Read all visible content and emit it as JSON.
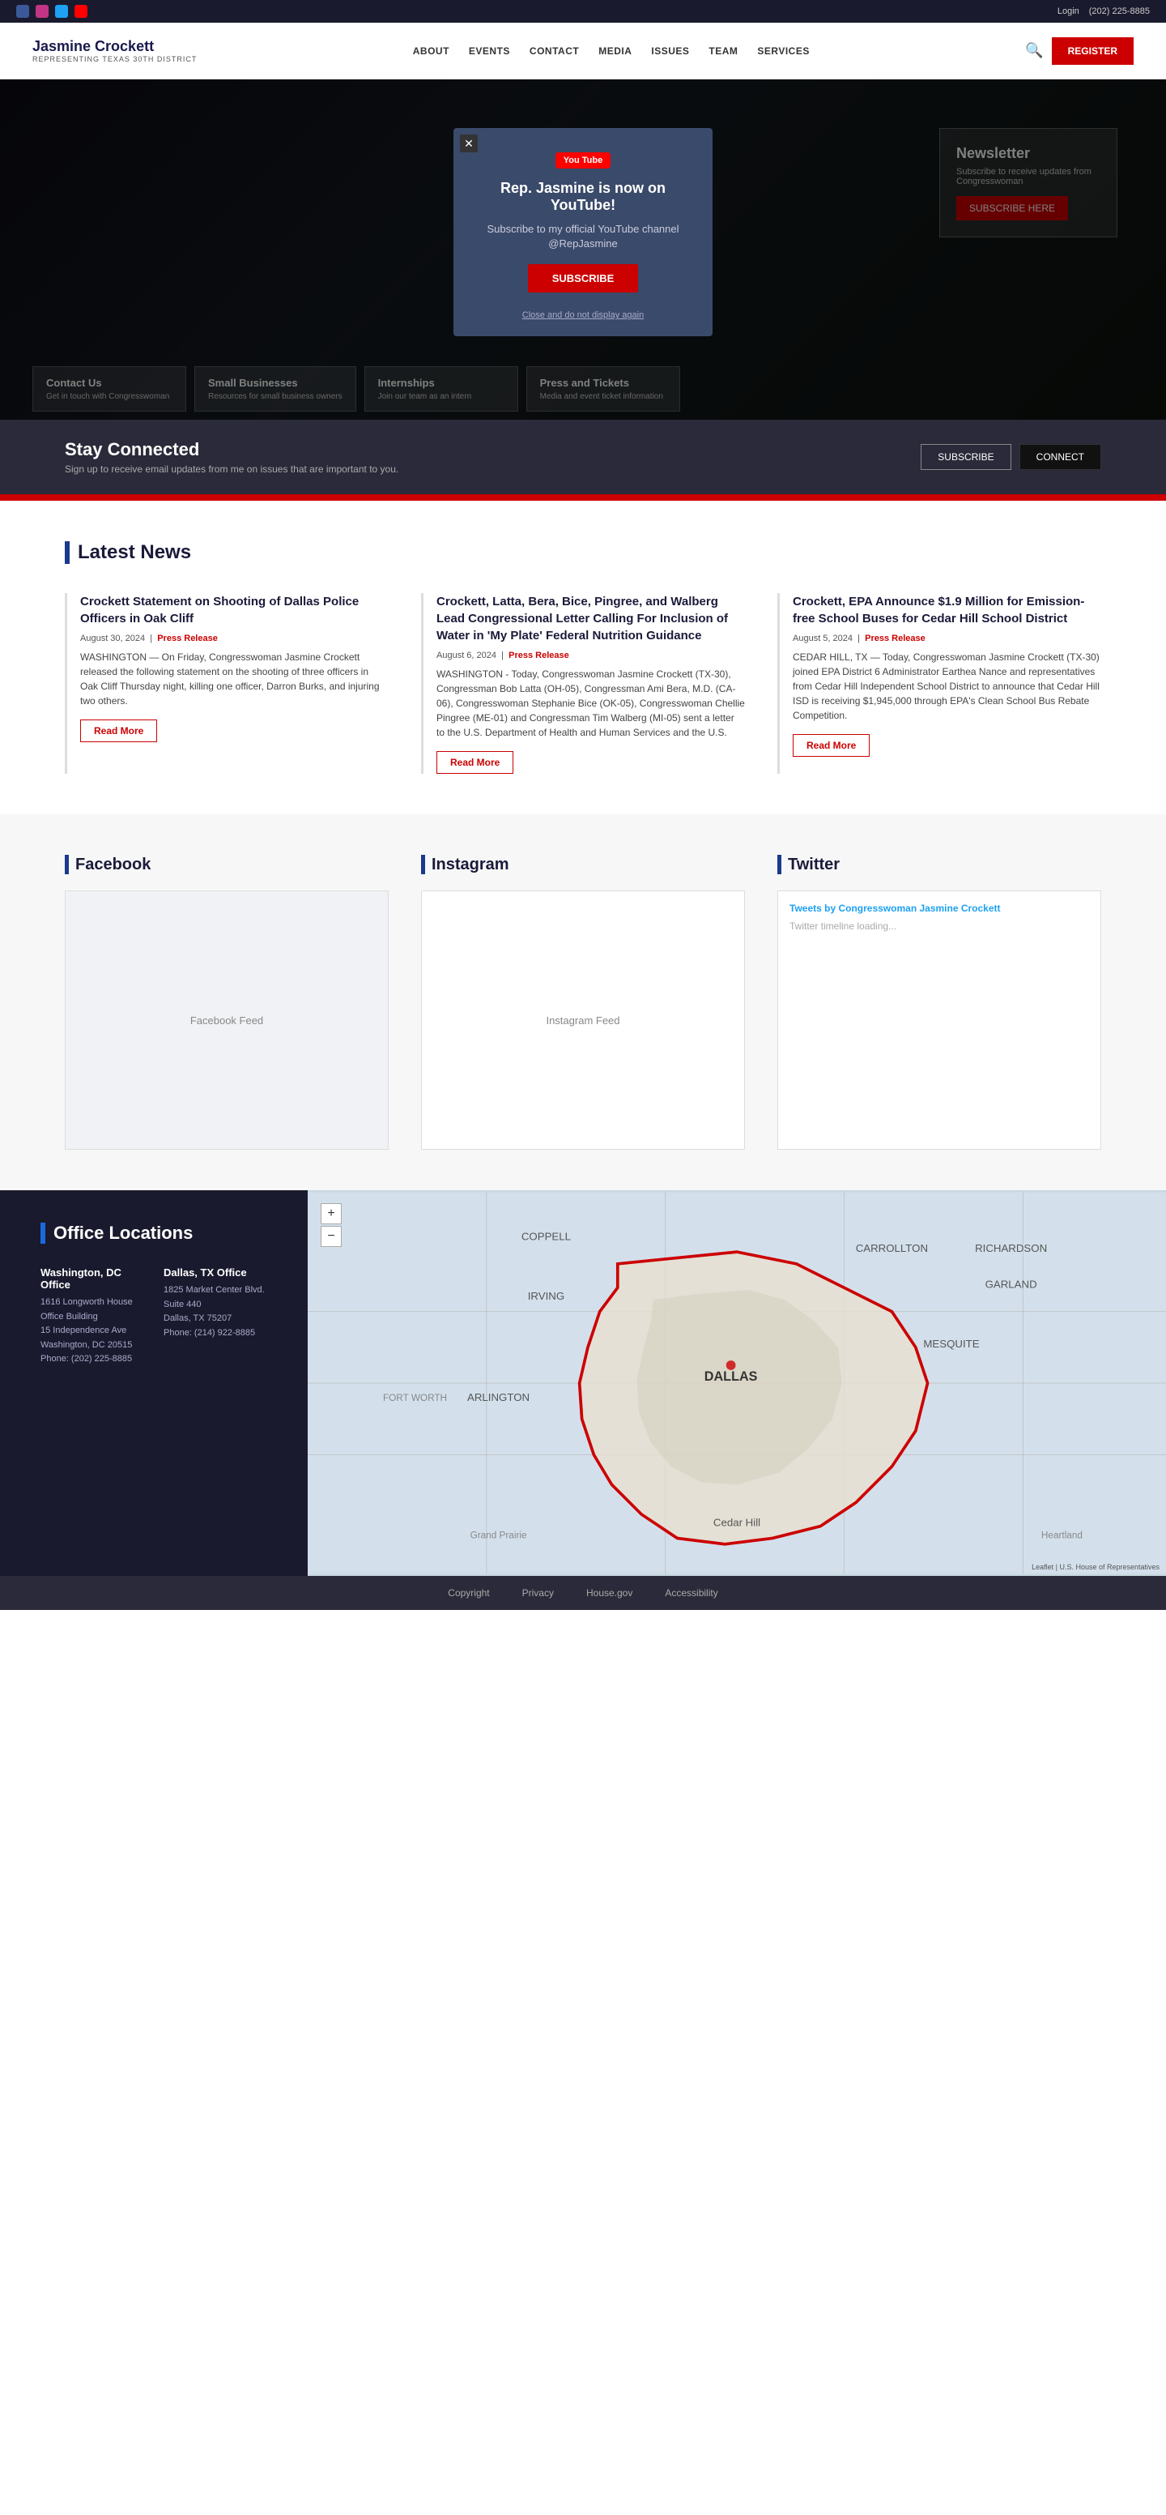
{
  "topbar": {
    "social_icons": [
      "facebook",
      "instagram",
      "twitter",
      "youtube"
    ],
    "right_links": [
      "login_label",
      "phone_label"
    ],
    "login_label": "Login",
    "phone_label": "(202) 225-8885"
  },
  "header": {
    "logo_name": "Jasmine Crockett",
    "logo_sub": "Representing Texas 30th District",
    "nav": [
      "About",
      "Events",
      "Contact",
      "Media",
      "Issues",
      "Team",
      "Services"
    ],
    "register_label": "Register"
  },
  "modal": {
    "youtube_label": "You Tube",
    "title": "Rep. Jasmine is now on YouTube!",
    "desc": "Subscribe to my official YouTube channel @RepJasmine",
    "subscribe_label": "SUBSCRIBE",
    "dismiss_label": "Close and do not display again"
  },
  "hero": {
    "newsletter_title": "Newsletter",
    "newsletter_desc": "Subscribe to receive updates from Congresswoman",
    "newsletter_btn": "SUBSCRIBE HERE",
    "cards": [
      {
        "icon": "✏️",
        "title": "Contact Us",
        "sub": "Get in touch with Congresswoman"
      },
      {
        "icon": "🏢",
        "title": "Small Businesses",
        "sub": "Resources for small business owners"
      },
      {
        "icon": "👤",
        "title": "Internships",
        "sub": "Join our team as an intern"
      },
      {
        "icon": "🎟️",
        "title": "Press and Tickets",
        "sub": "Media and event ticket information"
      }
    ]
  },
  "stay_connected": {
    "title": "Stay Connected",
    "desc": "Sign up to receive email updates from me on issues that are important to you.",
    "subscribe_label": "SUBSCRIBE",
    "connect_label": "CONNECT"
  },
  "latest_news": {
    "section_title": "Latest News",
    "articles": [
      {
        "title": "Crockett Statement on Shooting of Dallas Police Officers in Oak Cliff",
        "date": "August 30, 2024",
        "tag": "Press Release",
        "body": "WASHINGTON — On Friday, Congresswoman Jasmine Crockett released the following statement on the shooting of three officers in Oak Cliff Thursday night, killing one officer, Darron Burks, and injuring two others.",
        "read_more": "Read More"
      },
      {
        "title": "Crockett, Latta, Bera, Bice, Pingree, and Walberg Lead Congressional Letter Calling For Inclusion of Water in 'My Plate' Federal Nutrition Guidance",
        "date": "August 6, 2024",
        "tag": "Press Release",
        "body": "WASHINGTON - Today, Congresswoman Jasmine Crockett (TX-30), Congressman Bob Latta (OH-05), Congressman Ami Bera, M.D. (CA-06), Congresswoman Stephanie Bice (OK-05), Congresswoman Chellie Pingree (ME-01) and Congressman Tim Walberg (MI-05) sent a letter to the U.S. Department of Health and Human Services and the U.S.",
        "read_more": "Read More"
      },
      {
        "title": "Crockett, EPA Announce $1.9 Million for Emission-free School Buses for Cedar Hill School District",
        "date": "August 5, 2024",
        "tag": "Press Release",
        "body": "CEDAR HILL, TX — Today, Congresswoman Jasmine Crockett (TX-30) joined EPA District 6 Administrator Earthea Nance and representatives from Cedar Hill Independent School District to announce that Cedar Hill ISD is receiving $1,945,000 through EPA's Clean School Bus Rebate Competition.",
        "read_more": "Read More"
      }
    ]
  },
  "social": {
    "facebook_title": "Facebook",
    "instagram_title": "Instagram",
    "twitter_title": "Twitter",
    "twitter_handle": "Tweets by Congresswoman Jasmine Crockett"
  },
  "offices": {
    "section_title": "Office Locations",
    "locations": [
      {
        "name": "Washington, DC Office",
        "address": "1616 Longworth House Office Building\n15 Independence Ave\nWashington, DC 20515",
        "phone": "Phone: (202) 225-8885"
      },
      {
        "name": "Dallas, TX Office",
        "address": "1825 Market Center Blvd.\nSuite 440\nDallas, TX 75207",
        "phone": "Phone: (214) 922-8885"
      }
    ],
    "map_zoom_in": "+",
    "map_zoom_out": "−",
    "map_attribution": "Leaflet | U.S. House of Representatives"
  },
  "footer": {
    "links": [
      "Copyright",
      "Privacy",
      "House.gov",
      "Accessibility"
    ]
  }
}
